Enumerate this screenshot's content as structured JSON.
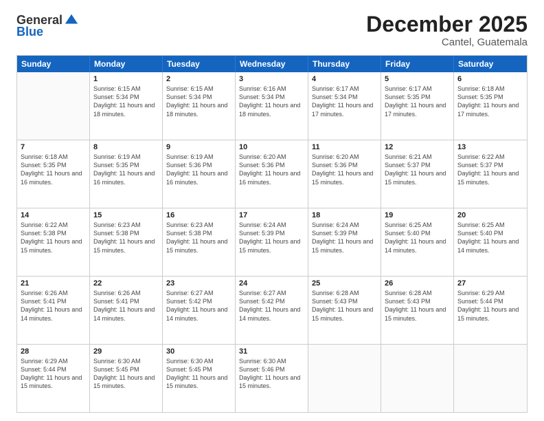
{
  "logo": {
    "general": "General",
    "blue": "Blue"
  },
  "title": "December 2025",
  "subtitle": "Cantel, Guatemala",
  "header_days": [
    "Sunday",
    "Monday",
    "Tuesday",
    "Wednesday",
    "Thursday",
    "Friday",
    "Saturday"
  ],
  "weeks": [
    [
      {
        "day": "",
        "empty": true
      },
      {
        "day": "1",
        "sunrise": "6:15 AM",
        "sunset": "5:34 PM",
        "daylight": "11 hours and 18 minutes."
      },
      {
        "day": "2",
        "sunrise": "6:15 AM",
        "sunset": "5:34 PM",
        "daylight": "11 hours and 18 minutes."
      },
      {
        "day": "3",
        "sunrise": "6:16 AM",
        "sunset": "5:34 PM",
        "daylight": "11 hours and 18 minutes."
      },
      {
        "day": "4",
        "sunrise": "6:17 AM",
        "sunset": "5:34 PM",
        "daylight": "11 hours and 17 minutes."
      },
      {
        "day": "5",
        "sunrise": "6:17 AM",
        "sunset": "5:35 PM",
        "daylight": "11 hours and 17 minutes."
      },
      {
        "day": "6",
        "sunrise": "6:18 AM",
        "sunset": "5:35 PM",
        "daylight": "11 hours and 17 minutes."
      }
    ],
    [
      {
        "day": "7",
        "sunrise": "6:18 AM",
        "sunset": "5:35 PM",
        "daylight": "11 hours and 16 minutes."
      },
      {
        "day": "8",
        "sunrise": "6:19 AM",
        "sunset": "5:35 PM",
        "daylight": "11 hours and 16 minutes."
      },
      {
        "day": "9",
        "sunrise": "6:19 AM",
        "sunset": "5:36 PM",
        "daylight": "11 hours and 16 minutes."
      },
      {
        "day": "10",
        "sunrise": "6:20 AM",
        "sunset": "5:36 PM",
        "daylight": "11 hours and 16 minutes."
      },
      {
        "day": "11",
        "sunrise": "6:20 AM",
        "sunset": "5:36 PM",
        "daylight": "11 hours and 15 minutes."
      },
      {
        "day": "12",
        "sunrise": "6:21 AM",
        "sunset": "5:37 PM",
        "daylight": "11 hours and 15 minutes."
      },
      {
        "day": "13",
        "sunrise": "6:22 AM",
        "sunset": "5:37 PM",
        "daylight": "11 hours and 15 minutes."
      }
    ],
    [
      {
        "day": "14",
        "sunrise": "6:22 AM",
        "sunset": "5:38 PM",
        "daylight": "11 hours and 15 minutes."
      },
      {
        "day": "15",
        "sunrise": "6:23 AM",
        "sunset": "5:38 PM",
        "daylight": "11 hours and 15 minutes."
      },
      {
        "day": "16",
        "sunrise": "6:23 AM",
        "sunset": "5:38 PM",
        "daylight": "11 hours and 15 minutes."
      },
      {
        "day": "17",
        "sunrise": "6:24 AM",
        "sunset": "5:39 PM",
        "daylight": "11 hours and 15 minutes."
      },
      {
        "day": "18",
        "sunrise": "6:24 AM",
        "sunset": "5:39 PM",
        "daylight": "11 hours and 15 minutes."
      },
      {
        "day": "19",
        "sunrise": "6:25 AM",
        "sunset": "5:40 PM",
        "daylight": "11 hours and 14 minutes."
      },
      {
        "day": "20",
        "sunrise": "6:25 AM",
        "sunset": "5:40 PM",
        "daylight": "11 hours and 14 minutes."
      }
    ],
    [
      {
        "day": "21",
        "sunrise": "6:26 AM",
        "sunset": "5:41 PM",
        "daylight": "11 hours and 14 minutes."
      },
      {
        "day": "22",
        "sunrise": "6:26 AM",
        "sunset": "5:41 PM",
        "daylight": "11 hours and 14 minutes."
      },
      {
        "day": "23",
        "sunrise": "6:27 AM",
        "sunset": "5:42 PM",
        "daylight": "11 hours and 14 minutes."
      },
      {
        "day": "24",
        "sunrise": "6:27 AM",
        "sunset": "5:42 PM",
        "daylight": "11 hours and 14 minutes."
      },
      {
        "day": "25",
        "sunrise": "6:28 AM",
        "sunset": "5:43 PM",
        "daylight": "11 hours and 15 minutes."
      },
      {
        "day": "26",
        "sunrise": "6:28 AM",
        "sunset": "5:43 PM",
        "daylight": "11 hours and 15 minutes."
      },
      {
        "day": "27",
        "sunrise": "6:29 AM",
        "sunset": "5:44 PM",
        "daylight": "11 hours and 15 minutes."
      }
    ],
    [
      {
        "day": "28",
        "sunrise": "6:29 AM",
        "sunset": "5:44 PM",
        "daylight": "11 hours and 15 minutes."
      },
      {
        "day": "29",
        "sunrise": "6:30 AM",
        "sunset": "5:45 PM",
        "daylight": "11 hours and 15 minutes."
      },
      {
        "day": "30",
        "sunrise": "6:30 AM",
        "sunset": "5:45 PM",
        "daylight": "11 hours and 15 minutes."
      },
      {
        "day": "31",
        "sunrise": "6:30 AM",
        "sunset": "5:46 PM",
        "daylight": "11 hours and 15 minutes."
      },
      {
        "day": "",
        "empty": true
      },
      {
        "day": "",
        "empty": true
      },
      {
        "day": "",
        "empty": true
      }
    ]
  ]
}
